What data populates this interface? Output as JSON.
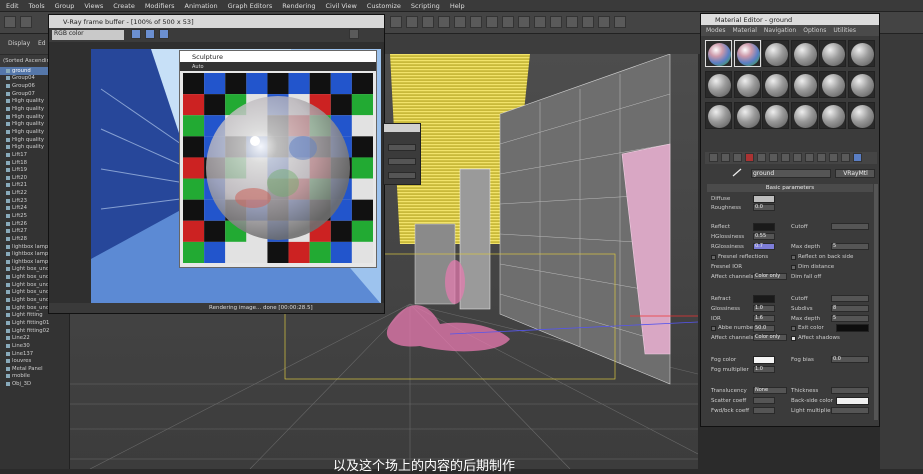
{
  "menubar": {
    "items": [
      "Edit",
      "Tools",
      "Group",
      "Views",
      "Create",
      "Modifiers",
      "Animation",
      "Graph Editors",
      "Rendering",
      "Civil View",
      "Customize",
      "Scripting",
      "Help"
    ]
  },
  "ribbon": {
    "tab1": "Display",
    "tab2": "Ed"
  },
  "scene_explorer": {
    "header": "(Sorted Ascending)",
    "items": [
      "ground",
      "Group04",
      "Group06",
      "Group07",
      "High quality",
      "High quality",
      "High quality",
      "High quality",
      "High quality",
      "High quality",
      "High quality",
      "Lift17",
      "Lift18",
      "Lift19",
      "Lift20",
      "Lift21",
      "Lift22",
      "Lift23",
      "Lift24",
      "Lift25",
      "Lift26",
      "Lift27",
      "Lift28",
      "lightbox lamp",
      "lightbox lamp",
      "lightbox lamp",
      "Light box_under",
      "Light box_under",
      "Light box_under",
      "Light box_under",
      "Light box_under",
      "Light box_under",
      "Light fitting",
      "Light fitting01",
      "Light fitting02",
      "Line22",
      "Line30",
      "Line137",
      "louvres",
      "Metal Panel",
      "mobile",
      "Obj_3D"
    ]
  },
  "vfb": {
    "title": "V-Ray frame buffer - [100% of 500 x 53]",
    "channel": "RGB color",
    "status": "Rendering image... done [00:00:28.5]"
  },
  "sculpture": {
    "title": "Sculpture",
    "bar_label": "Auto"
  },
  "material_editor": {
    "title": "Material Editor - ground",
    "menus": [
      "Modes",
      "Material",
      "Navigation",
      "Options",
      "Utilities"
    ],
    "material_name": "ground",
    "material_type": "VRayMtl",
    "basic_params": "Basic parameters",
    "diffuse_label": "Diffuse",
    "roughness_label": "Roughness",
    "roughness_value": "0.0",
    "reflect_label": "Reflect",
    "hglossiness_label": "HGlossiness",
    "hglossiness_value": "0.55",
    "rglossiness_label": "RGlossiness",
    "rglossiness_value": "0.7",
    "fresnel_label": "Fresnel reflections",
    "fresnel_ior_label": "Fresnel IOR",
    "subdivs_label": "Subdivs",
    "subdivs_value": "8",
    "max_depth_label": "Max depth",
    "max_depth_value": "5",
    "reflect_backside": "Reflect on back side",
    "dim_distance": "Dim distance",
    "affect_channels_label": "Affect channels",
    "affect_channels_value": "Color only",
    "dim_falloff": "Dim fall off",
    "refract_label": "Refract",
    "glossiness_label": "Glossiness",
    "glossiness_value": "1.0",
    "ior_label": "IOR",
    "ior_value": "1.6",
    "abbe_label": "Abbe number",
    "abbe_value": "50.0",
    "refr_subdivs_value": "8",
    "refr_max_depth_value": "5",
    "exit_color": "Exit color",
    "affect_shadows": "Affect shadows",
    "refr_affect_channels": "Color only",
    "fog_color_label": "Fog color",
    "fog_multiplier_label": "Fog multiplier",
    "fog_multiplier_value": "1.0",
    "fog_bias_label": "Fog bias",
    "fog_bias_value": "0.0",
    "translucency_label": "Translucency",
    "translucency_value": "None",
    "scatter_coeff_label": "Scatter coeff",
    "fwd_bck_label": "Fwd/bck coeff",
    "thickness_label": "Thickness",
    "back_side_color_label": "Back-side color",
    "light_multiplier_label": "Light multiplier",
    "cutoff_label": "Cutoff"
  },
  "subtitle": "以及这个场上的内容的后期制作",
  "colors": {
    "accent": "#5577aa",
    "yellow": "#e8d84a",
    "pink": "#e87ab0",
    "blue_render": "#6c9dd9"
  }
}
